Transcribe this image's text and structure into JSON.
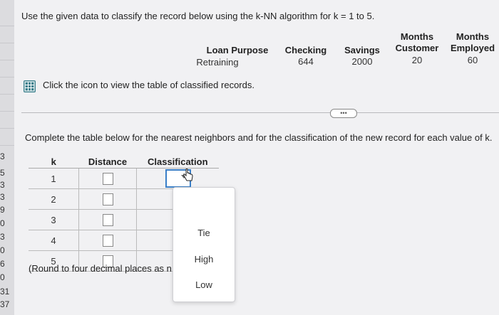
{
  "question": "Use the given data to classify the record below using the k-NN algorithm for k = 1 to 5.",
  "record": {
    "loan_purpose": {
      "header": "Loan Purpose",
      "value": "Retraining"
    },
    "checking": {
      "header": "Checking",
      "value": "644"
    },
    "savings": {
      "header": "Savings",
      "value": "2000"
    },
    "months_customer": {
      "header_1": "Months",
      "header_2": "Customer",
      "value": "20"
    },
    "months_employed": {
      "header_1": "Months",
      "header_2": "Employed",
      "value": "60"
    }
  },
  "icon_link_text": "Click the icon to view the table of classified records.",
  "expand_dots": "•••",
  "instructions": "Complete the table below for the nearest neighbors and for the classification of the new record for each value of k.",
  "table": {
    "headers": {
      "k": "k",
      "distance": "Distance",
      "classification": "Classification"
    },
    "rows": [
      {
        "k": "1"
      },
      {
        "k": "2"
      },
      {
        "k": "3"
      },
      {
        "k": "4"
      },
      {
        "k": "5"
      }
    ]
  },
  "round_note": "(Round to four decimal places as ne",
  "dropdown_options": [
    "Tie",
    "High",
    "Low"
  ],
  "left_strip_numbers": [
    "3",
    "5",
    "3",
    "3",
    "9",
    "0",
    "3",
    "0",
    "6",
    "0",
    "31",
    "37"
  ]
}
